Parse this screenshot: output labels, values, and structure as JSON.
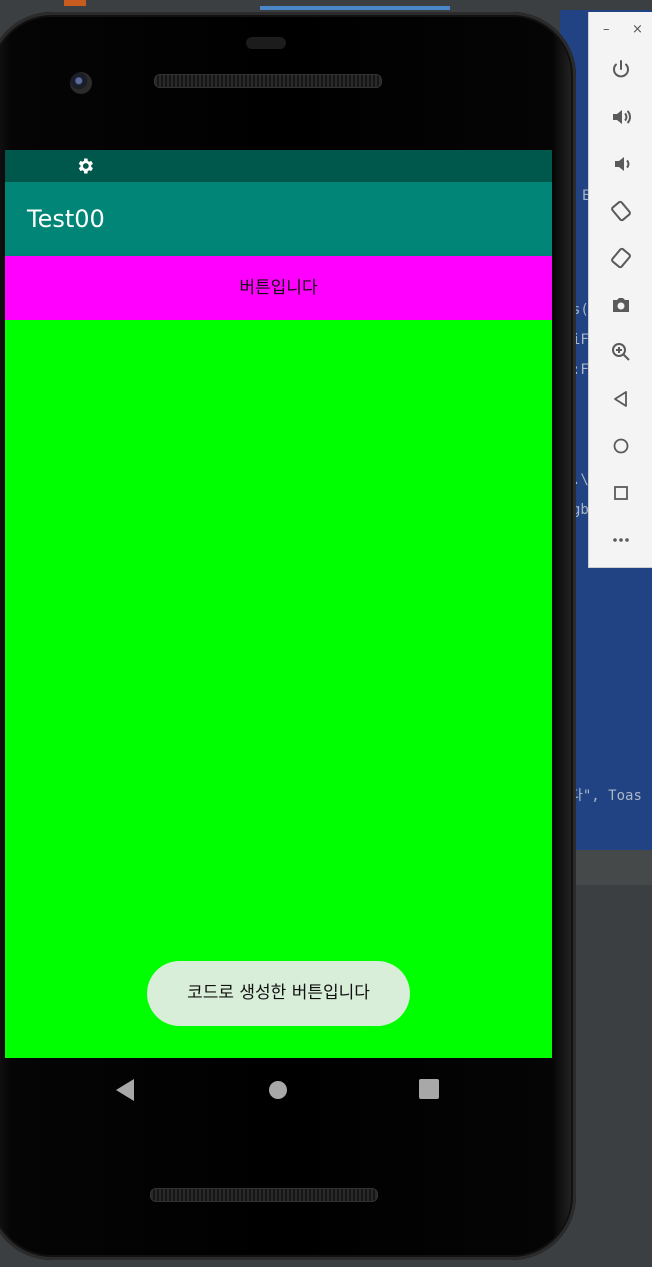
{
  "phone_screen": {
    "app_title": "Test00",
    "button_label": "버튼입니다",
    "toast_text": "코드로 생성한 버튼입니다",
    "colors": {
      "status_bar": "#00574b",
      "app_bar": "#008577",
      "button": "#ff00ff",
      "content": "#00ff00",
      "toast": "#d9eed9"
    }
  },
  "emulator_toolbar": {
    "minimize": "–",
    "close": "×",
    "buttons": [
      "power-icon",
      "volume-up-icon",
      "volume-down-icon",
      "rotate-left-icon",
      "rotate-right-icon",
      "camera-icon",
      "zoom-icon",
      "back-icon",
      "home-icon",
      "overview-icon",
      "more-icon"
    ]
  },
  "ide_fragments": {
    "line1": "E",
    "line2": ")",
    "line3": "s(",
    "line4": "iF",
    "line5": ":F",
    "line6": ".\\",
    "line7": "gb",
    "line8": "다\", Toas"
  }
}
